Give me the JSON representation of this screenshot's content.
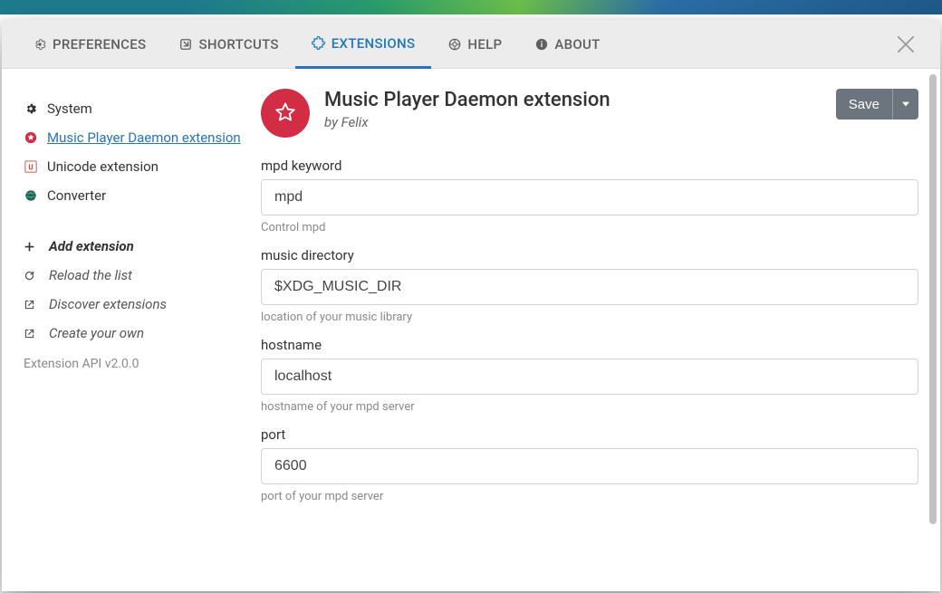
{
  "tabs": {
    "preferences": "PREFERENCES",
    "shortcuts": "SHORTCUTS",
    "extensions": "EXTENSIONS",
    "help": "HELP",
    "about": "ABOUT"
  },
  "sidebar": {
    "items": [
      {
        "label": "System"
      },
      {
        "label": "Music Player Daemon extension"
      },
      {
        "label": "Unicode extension"
      },
      {
        "label": "Converter"
      }
    ],
    "actions": {
      "add": "Add extension",
      "reload": "Reload the list",
      "discover": "Discover extensions",
      "create": "Create your own"
    },
    "api_version": "Extension API v2.0.0"
  },
  "extension": {
    "title": "Music Player Daemon extension",
    "author_prefix": "by ",
    "author": "Felix",
    "save_label": "Save"
  },
  "form": {
    "keyword": {
      "label": "mpd keyword",
      "value": "mpd",
      "help": "Control mpd"
    },
    "musicdir": {
      "label": "music directory",
      "value": "$XDG_MUSIC_DIR",
      "help": "location of your music library"
    },
    "hostname": {
      "label": "hostname",
      "value": "localhost",
      "help": "hostname of your mpd server"
    },
    "port": {
      "label": "port",
      "value": "6600",
      "help": "port of your mpd server"
    }
  }
}
